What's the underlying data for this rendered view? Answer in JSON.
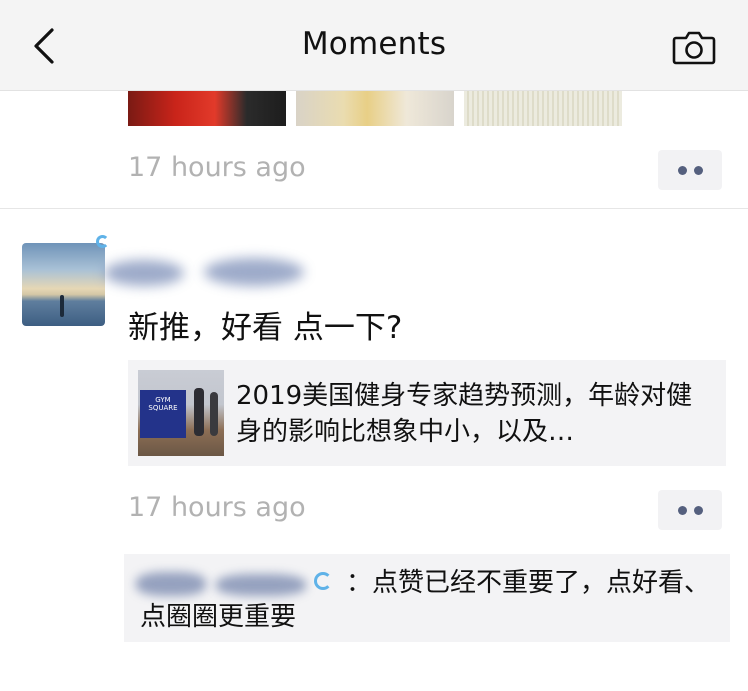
{
  "nav": {
    "title": "Moments",
    "back_icon": "chevron-left-icon",
    "camera_icon": "camera-icon",
    "background": "#f4f4f4"
  },
  "posts": [
    {
      "timestamp": "17 hours ago"
    },
    {
      "text": "新推，好看 点一下?",
      "shared_article": {
        "title": "2019美国健身专家趋势预测，年龄对健身的影响比想象中小，以及…",
        "thumbnail_text": "GYM SQUARE"
      },
      "timestamp": "17 hours ago",
      "comments": [
        {
          "text": "：点赞已经不重要了，点好看、点圈圈更重要"
        }
      ]
    }
  ],
  "colors": {
    "timestamp": "#b2b2b2",
    "more_dots": "#55607e",
    "link_box": "#f3f3f5"
  }
}
